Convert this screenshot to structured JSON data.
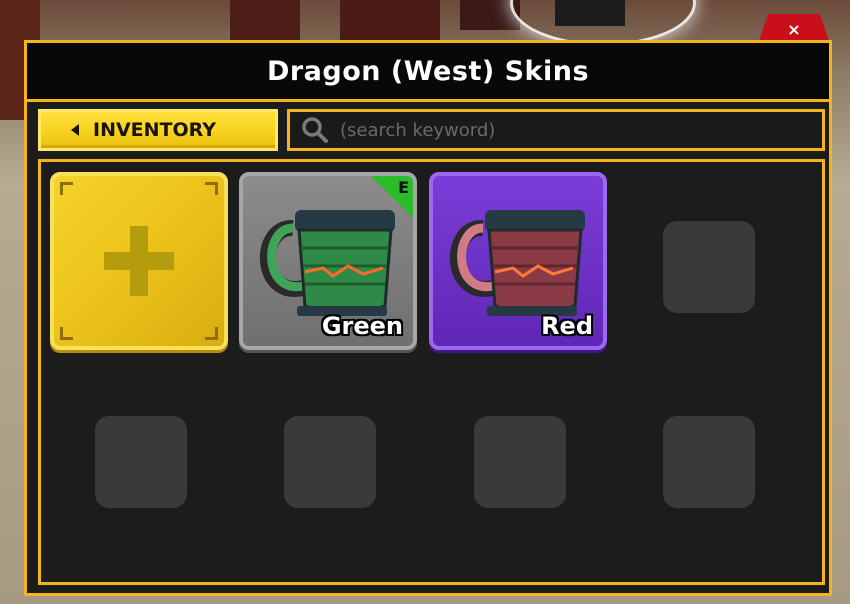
{
  "window": {
    "title": "Dragon (West) Skins",
    "close_label": "×"
  },
  "toolbar": {
    "inventory_label": "INVENTORY",
    "search_placeholder": "(search keyword)",
    "search_value": ""
  },
  "skins": [
    {
      "slot": "add",
      "icon": "plus-icon"
    },
    {
      "name": "Green",
      "equipped": true,
      "equipped_badge": "E",
      "rarity_color": "#8c8c8c",
      "mug_color": "#2f8a47"
    },
    {
      "name": "Red",
      "equipped": false,
      "rarity_color": "#6f2fc9",
      "mug_color": "#8a3a45"
    }
  ],
  "empty_slot_count": 5,
  "colors": {
    "accent": "#f2b51b",
    "panel_bg": "#1c1c1c",
    "close": "#c9101a"
  }
}
